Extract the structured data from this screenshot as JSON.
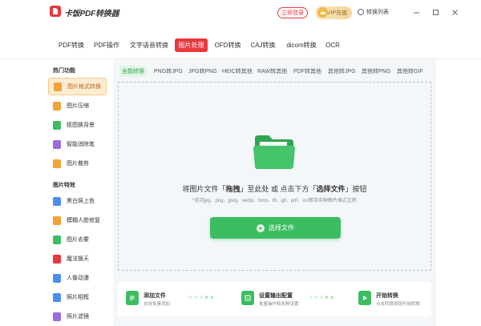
{
  "app": {
    "title": "卡饭PDF转换器"
  },
  "header": {
    "login_label": "立即登录",
    "vip_label": "VIP充值",
    "convert_list_label": "转换列表"
  },
  "topnav": {
    "tabs": [
      {
        "label": "PDF转换"
      },
      {
        "label": "PDF操作"
      },
      {
        "label": "文字语音转换"
      },
      {
        "label": "图片处理",
        "active": true
      },
      {
        "label": "OFD转换"
      },
      {
        "label": "CAJ转换"
      },
      {
        "label": "dicom转换"
      },
      {
        "label": "OCR"
      }
    ]
  },
  "sidebar": {
    "hot_title": "热门功能",
    "hot_items": [
      {
        "label": "图片格式转换",
        "active": true,
        "color": "#f2a33a"
      },
      {
        "label": "图片压缩",
        "color": "#f2a33a"
      },
      {
        "label": "抠图换背景",
        "color": "#3dbd61"
      },
      {
        "label": "智能消除笔",
        "color": "#9b6bdf"
      },
      {
        "label": "图片裁剪",
        "color": "#f2a33a"
      }
    ],
    "special_title": "图片特效",
    "special_items": [
      {
        "label": "黑白照上色",
        "color": "#4a8ff0"
      },
      {
        "label": "模糊人脸修复",
        "color": "#f2a33a"
      },
      {
        "label": "图片去雾",
        "color": "#3dbd61"
      },
      {
        "label": "魔法换天",
        "color": "#e8383d"
      },
      {
        "label": "人像动漫",
        "color": "#4a8ff0"
      },
      {
        "label": "照片相框",
        "color": "#4a8ff0"
      },
      {
        "label": "照片滤镜",
        "color": "#9b6bdf"
      }
    ]
  },
  "subtabs": [
    {
      "label": "全能转换",
      "active": true
    },
    {
      "label": "PNG转JPG"
    },
    {
      "label": "JPG转PNG"
    },
    {
      "label": "HEIC转其他"
    },
    {
      "label": "RAW转其他"
    },
    {
      "label": "PDF转其他"
    },
    {
      "label": "其他转JPG"
    },
    {
      "label": "其他转PNG"
    },
    {
      "label": "其他转GIF"
    }
  ],
  "dropzone": {
    "text_1": "将图片文件「",
    "text_drag": "拖拽",
    "text_2": "」至此处 或 点击下方「",
    "text_select": "选择文件",
    "text_3": "」按钮",
    "sub": "*支持jpg、png、jpeg、webp、bmp、tif、gif、pdf、ico等百余种图片格式互转",
    "button_label": "选择文件"
  },
  "steps": [
    {
      "title": "添加文件",
      "desc": "支持批量添加"
    },
    {
      "title": "设置输出配置",
      "desc": "批量操作和各种设置"
    },
    {
      "title": "开始转换",
      "desc": "点击转换按钮开始转换"
    }
  ],
  "colors": {
    "brand_red": "#e8383d",
    "accent_green": "#3dbd61",
    "active_orange_bg": "#fdecd1"
  }
}
